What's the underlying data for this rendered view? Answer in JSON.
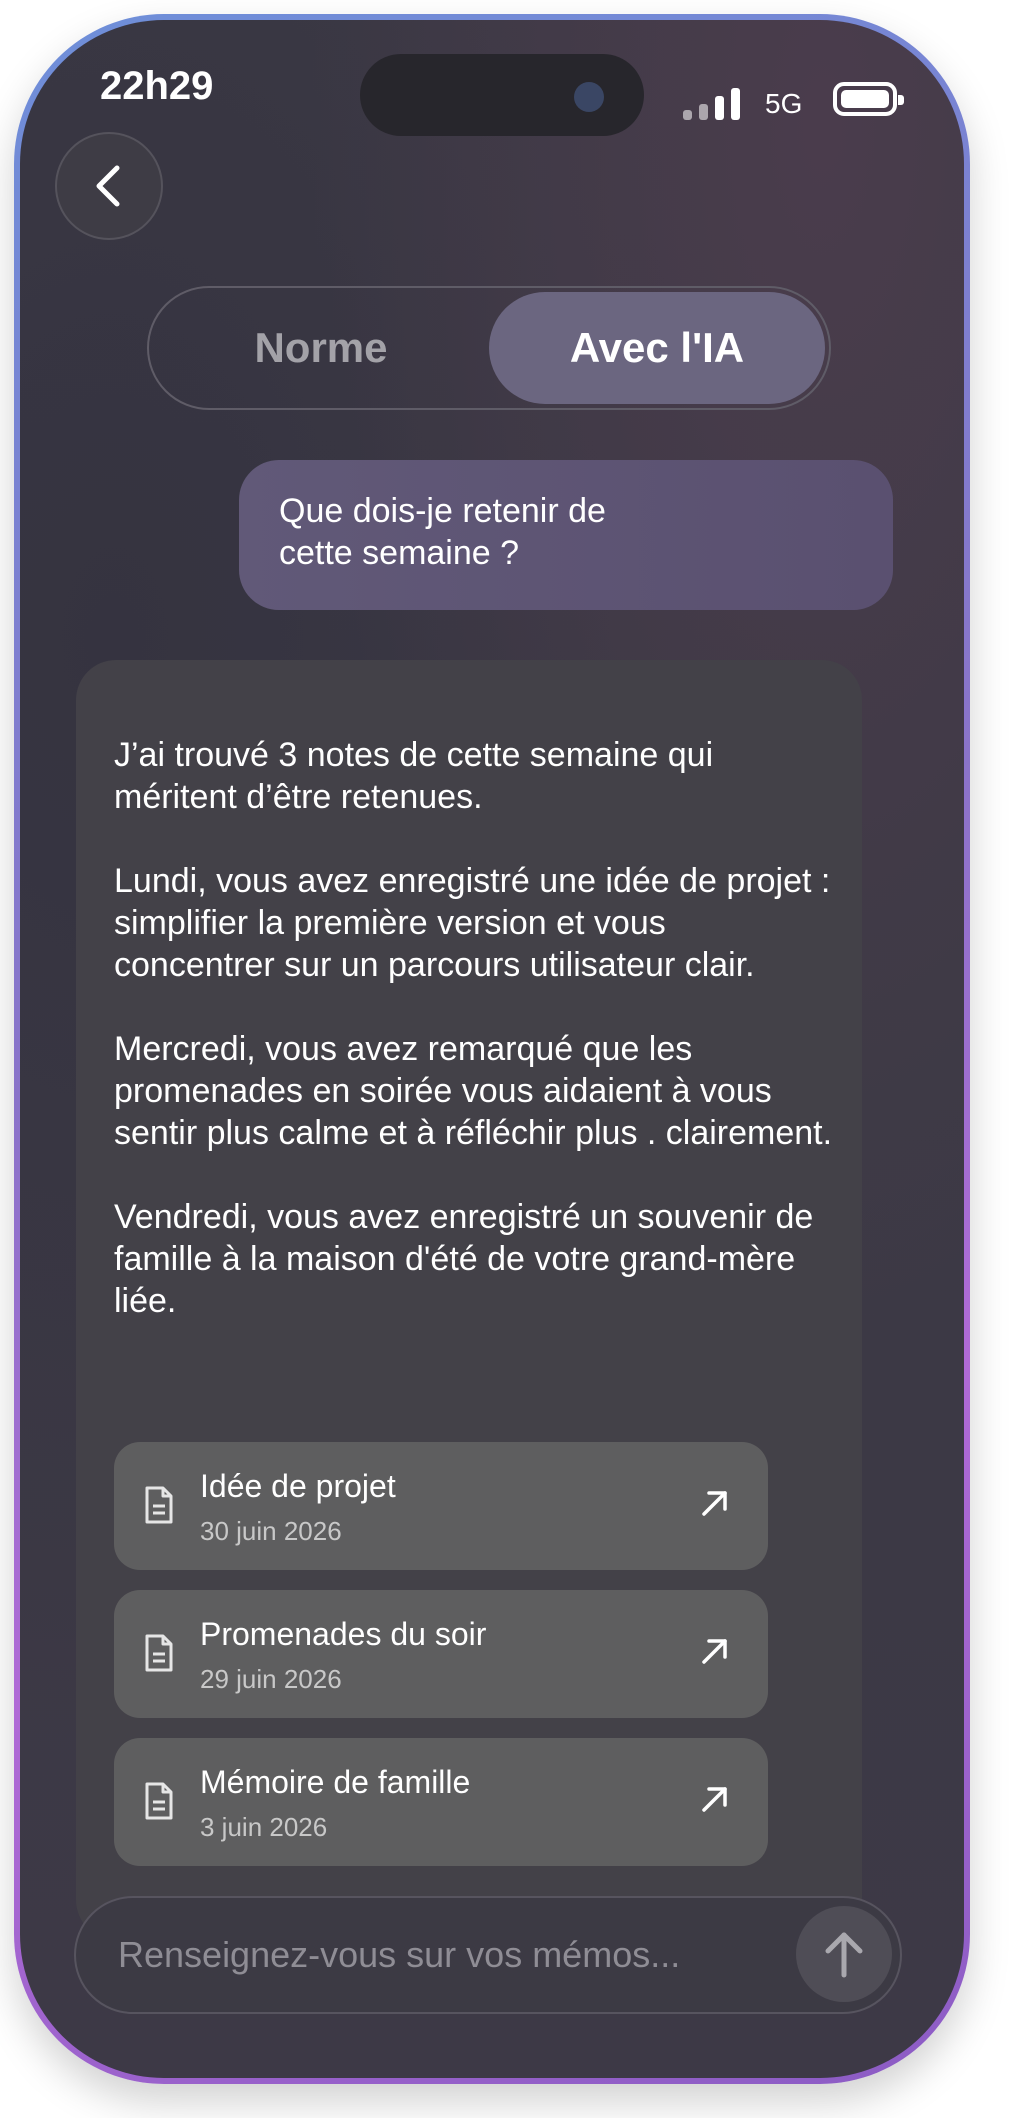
{
  "status_bar": {
    "time": "22h29",
    "network": "5G"
  },
  "segmented": {
    "option_norm": "Norme",
    "option_ai": "Avec l'IA",
    "selected": "Avec l'IA"
  },
  "user_message": "Que dois-je retenir de cette semaine ?",
  "ai_reply": {
    "paragraphs": [
      "J’ai trouvé 3 notes de cette semaine qui méritent d’être retenues.",
      "Lundi, vous avez enregistré une idée de projet : simplifier la première version et vous concentrer sur un parcours utilisateur clair.",
      "Mercredi, vous avez remarqué que les promenades en soirée vous aidaient à vous sentir plus calme et à réfléchir plus . clairement.",
      "Vendredi, vous avez enregistré un souvenir de famille à la maison d'été de votre grand-mère liée."
    ],
    "notes": [
      {
        "title": "Idée de projet",
        "date": "30 juin 2026"
      },
      {
        "title": "Promenades du soir",
        "date": "29 juin 2026"
      },
      {
        "title": "Mémoire de famille",
        "date": "3 juin 2026"
      }
    ]
  },
  "composer": {
    "placeholder": "Renseignez-vous sur vos mémos..."
  },
  "icons": {
    "back": "chevron-left-icon",
    "note": "document-icon",
    "open": "arrow-up-right-icon",
    "send": "arrow-up-icon"
  },
  "colors": {
    "accent": "#6b6680",
    "user_bubble": "#5d5474",
    "card": "#434148",
    "note_card": "#5e5e5f"
  }
}
